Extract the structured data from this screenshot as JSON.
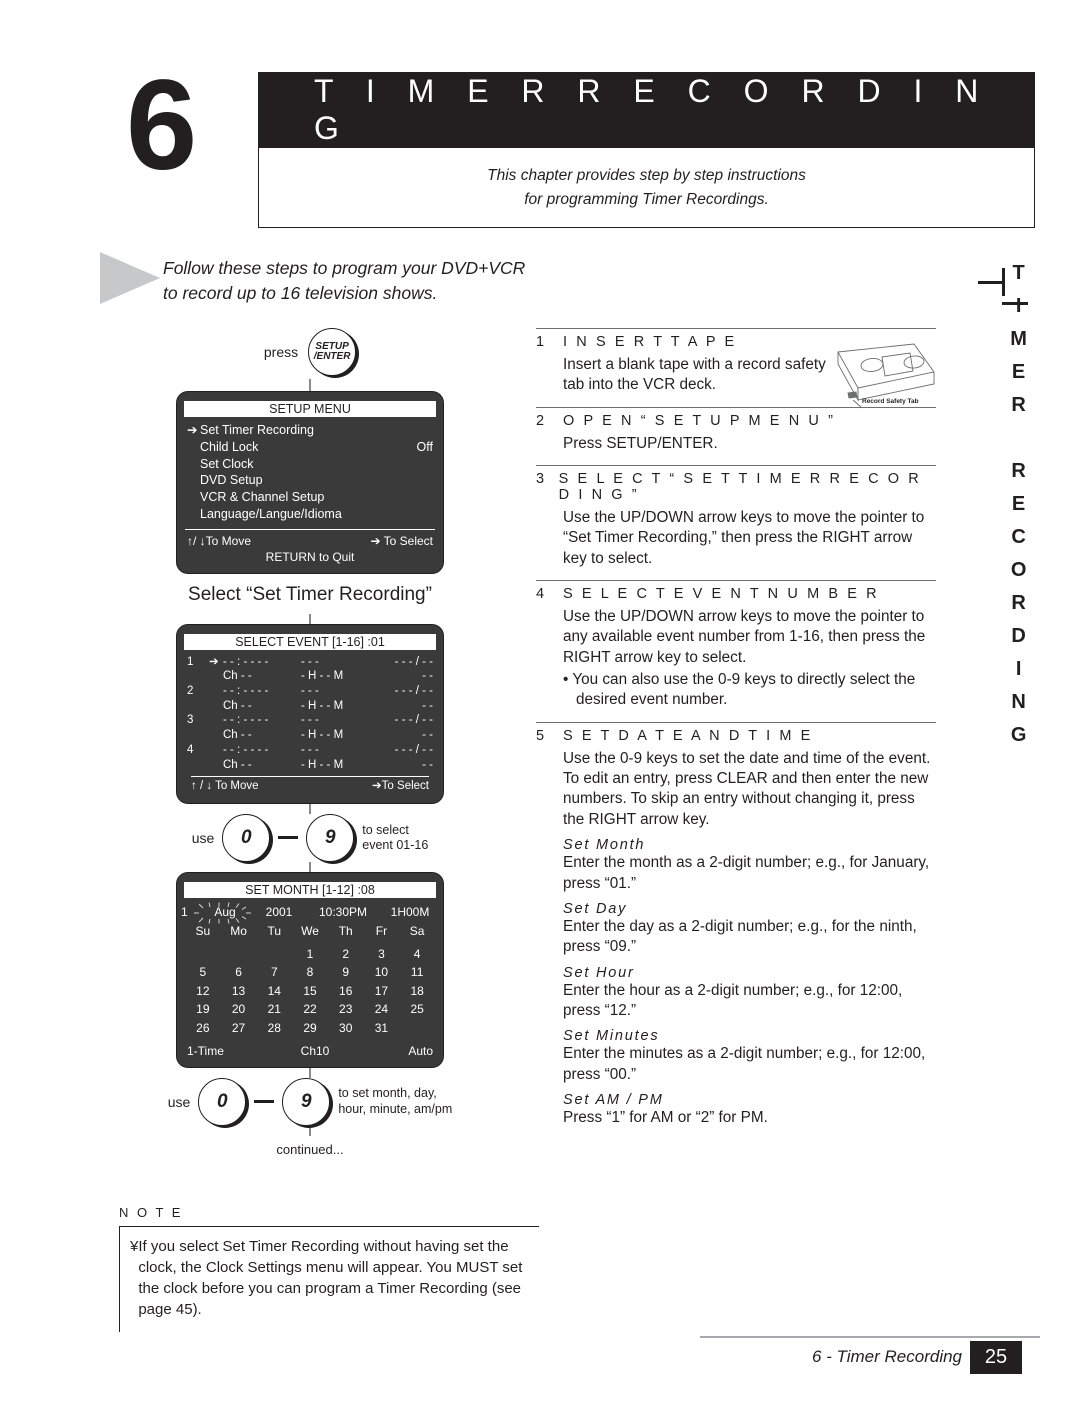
{
  "chapter": {
    "number": "6",
    "title": "T I M E R   R E C O R D I N G",
    "subtitle_line1": "This chapter provides step by step instructions",
    "subtitle_line2": "for programming Timer Recordings."
  },
  "intro": {
    "line1": "Follow these steps to program your DVD+VCR",
    "line2": "to record up to 16 television shows."
  },
  "side_tab": "TIMER RECORDING",
  "flow": {
    "press_label": "press",
    "setup_key_line1": "SETUP",
    "setup_key_line2": "/ENTER",
    "caption_select": "Select “Set Timer Recording”",
    "use_label_1": "use",
    "key_zero": "0",
    "key_nine": "9",
    "use_hint_1_line1": "to select",
    "use_hint_1_line2": "event 01-16",
    "use_label_2": "use",
    "use_hint_2_line1": "to set month, day,",
    "use_hint_2_line2": "hour, minute, am/pm",
    "continued": "continued..."
  },
  "setup_menu": {
    "title": "SETUP MENU",
    "items": [
      {
        "pointer": "➔",
        "label": "Set Timer Recording",
        "value": ""
      },
      {
        "pointer": "",
        "label": "Child Lock",
        "value": "Off"
      },
      {
        "pointer": "",
        "label": "Set Clock",
        "value": ""
      },
      {
        "pointer": "",
        "label": "DVD Setup",
        "value": ""
      },
      {
        "pointer": "",
        "label": "VCR & Channel Setup",
        "value": ""
      },
      {
        "pointer": "",
        "label": "Language/Langue/Idioma",
        "value": ""
      }
    ],
    "foot_left": "↑/ ↓To Move",
    "foot_right": "➔  To Select",
    "foot_center": "RETURN to Quit"
  },
  "select_event": {
    "title": "SELECT EVENT [1-16]  :01",
    "rows": [
      {
        "num": "1",
        "pointer": "➔",
        "date": "- - : - - - -",
        "blank": "- - -",
        "range": "- - - / - -",
        "ch": "Ch - -",
        "hm": "- H - - M",
        "spd": "- -"
      },
      {
        "num": "2",
        "pointer": "",
        "date": "- - : - - - -",
        "blank": "- - -",
        "range": "- - - / - -",
        "ch": "Ch - -",
        "hm": "- H - - M",
        "spd": "- -"
      },
      {
        "num": "3",
        "pointer": "",
        "date": "- - : - - - -",
        "blank": "- - -",
        "range": "- - - / - -",
        "ch": "Ch - -",
        "hm": "- H - - M",
        "spd": "- -"
      },
      {
        "num": "4",
        "pointer": "",
        "date": "- - : - - - -",
        "blank": "- - -",
        "range": "- - - / - -",
        "ch": "Ch - -",
        "hm": "- H - - M",
        "spd": "- -"
      }
    ],
    "foot_left": "↑ / ↓ To Move",
    "foot_right": "➔To Select"
  },
  "set_month": {
    "title": "SET MONTH [1-12]  :08",
    "event_index": "1",
    "month": "Aug",
    "year": "2001",
    "time": "10:30PM",
    "duration": "1H00M",
    "weekdays": [
      "Su",
      "Mo",
      "Tu",
      "We",
      "Th",
      "Fr",
      "Sa"
    ],
    "days": [
      "",
      "",
      "",
      "1",
      "2",
      "3",
      "4",
      "5",
      "6",
      "7",
      "8",
      "9",
      "10",
      "11",
      "12",
      "13",
      "14",
      "15",
      "16",
      "17",
      "18",
      "19",
      "20",
      "21",
      "22",
      "23",
      "24",
      "25",
      "26",
      "27",
      "28",
      "29",
      "30",
      "31",
      ""
    ],
    "foot_mode": "1-Time",
    "foot_channel": "Ch10",
    "foot_speed": "Auto"
  },
  "steps": [
    {
      "number": "1",
      "title": "I N S E R T   T A P E",
      "body": "Insert a blank tape with a record safety tab into the VCR deck.",
      "bullets": [],
      "subs": []
    },
    {
      "number": "2",
      "title": "O P E N   “ S E T U P   M E N U ”",
      "body": "Press SETUP/ENTER.",
      "bullets": [],
      "subs": []
    },
    {
      "number": "3",
      "title": "S E L E C T   “ S E T   T I M E R   R E C O R D I N G ”",
      "body": "Use the UP/DOWN arrow keys to move the pointer to “Set Timer Recording,” then press the RIGHT arrow key to select.",
      "bullets": [],
      "subs": []
    },
    {
      "number": "4",
      "title": "S E L E C T   E V E N T   N U M B E R",
      "body": "Use the UP/DOWN arrow keys to move the pointer to any available event number from 1-16, then press the RIGHT arrow key to select.",
      "bullets": [
        "You can also use the 0-9 keys to directly select the desired event number."
      ],
      "subs": []
    },
    {
      "number": "5",
      "title": "S E T   D A T E   A N D   T I M E",
      "body": "Use the 0-9 keys to set the date and time of the event. To edit an entry, press CLEAR and then enter the new numbers. To skip an entry without changing it, press the RIGHT arrow key.",
      "bullets": [],
      "subs": [
        {
          "head": "Set  Month",
          "body": "Enter the month as a 2-digit number; e.g., for January, press “01.”"
        },
        {
          "head": "Set  Day",
          "body": "Enter the day as a 2-digit number; e.g., for the ninth, press “09.”"
        },
        {
          "head": "Set  Hour",
          "body": "Enter the hour as a 2-digit number; e.g., for 12:00, press “12.”"
        },
        {
          "head": "Set  Minutes",
          "body": "Enter the minutes as a 2-digit number; e.g., for 12:00, press “00.”"
        },
        {
          "head": "Set  AM / PM",
          "body": "Press “1” for AM or “2” for PM."
        }
      ]
    }
  ],
  "tape_figure": {
    "caption": "Record Safety Tab"
  },
  "note": {
    "title": "N O T E",
    "bullet": "¥",
    "text": "If you select  Set Timer Recording  without having set the clock, the  Clock Settings  menu will appear. You MUST set the clock before you can program a Timer Recording (see page 45)."
  },
  "footer": {
    "label": "6 - Timer Recording",
    "page": "25"
  },
  "colors": {
    "ink": "#231f20",
    "osd_bg": "#3a3a3a",
    "rule": "#6d6e71",
    "triangle": "#c7c8ca"
  }
}
